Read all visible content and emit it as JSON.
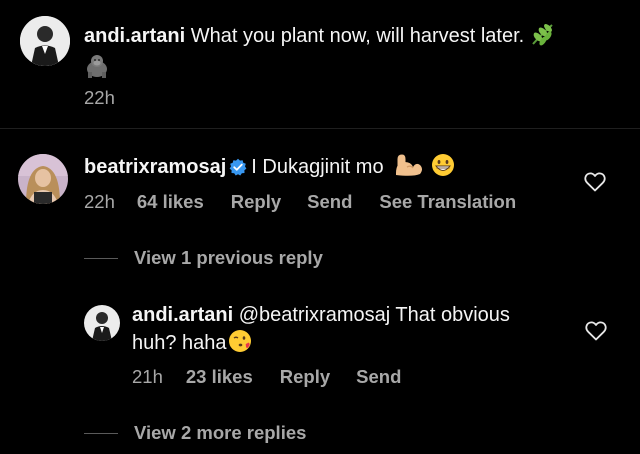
{
  "caption": {
    "username": "andi.artani",
    "text": "What you plant now, will harvest later.",
    "time": "22h"
  },
  "comment": {
    "username": "beatrixramosaj",
    "text": "I Dukagjinit mo",
    "time": "22h",
    "likes": "64 likes",
    "reply_label": "Reply",
    "send_label": "Send",
    "translation_label": "See Translation",
    "view_previous": "View 1 previous reply"
  },
  "reply": {
    "username": "andi.artani",
    "mention": "@beatrixramosaj",
    "text_line1": "That obvious",
    "text_line2": "huh? haha",
    "time": "21h",
    "likes": "23 likes",
    "reply_label": "Reply",
    "send_label": "Send",
    "view_more": "View 2 more replies"
  },
  "colors": {
    "background": "#000000",
    "primary_text": "#f5f5f5",
    "secondary_text": "#a8a8a8",
    "verified_badge": "#3897f0"
  },
  "icons": {
    "caption_emoji_1": "herb-emoji",
    "caption_emoji_2": "gorilla-emoji",
    "comment_emoji_1": "flexed-biceps-emoji",
    "comment_emoji_2": "grinning-face-emoji",
    "reply_emoji": "face-blowing-kiss-emoji",
    "like": "heart-outline-icon",
    "verified": "verified-badge-icon"
  }
}
